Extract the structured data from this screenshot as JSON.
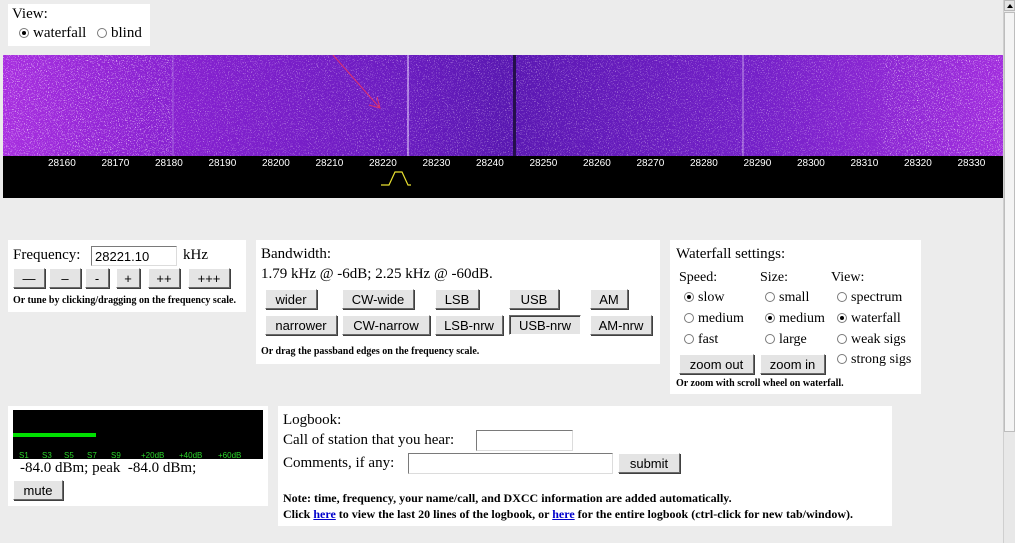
{
  "view_panel": {
    "title": "View:",
    "options": [
      {
        "label": "waterfall",
        "selected": true
      },
      {
        "label": "blind",
        "selected": false
      }
    ]
  },
  "waterfall": {
    "colors": {
      "base": "#8c1fd6",
      "dark": "#3c1478",
      "light": "#f2d6ff",
      "marker_arrow": "#e0306a"
    }
  },
  "scale": {
    "ticks": [
      "28160",
      "28170",
      "28180",
      "28190",
      "28200",
      "28210",
      "28220",
      "28230",
      "28240",
      "28250",
      "28260",
      "28270",
      "28280",
      "28290",
      "28300",
      "28310",
      "28320",
      "28330"
    ]
  },
  "frequency": {
    "label": "Frequency:",
    "value": "28221.10",
    "unit": "kHz",
    "buttons": [
      "—",
      "–",
      "-",
      "+",
      "++",
      "+++"
    ],
    "hint": "Or tune by clicking/dragging on the frequency scale."
  },
  "bandwidth": {
    "title": "Bandwidth:",
    "info": "1.79 kHz @ -6dB; 2.25 kHz @ -60dB.",
    "row1": [
      "wider",
      "CW-wide",
      "LSB",
      "USB",
      "AM"
    ],
    "row2": [
      "narrower",
      "CW-narrow",
      "LSB-nrw",
      "USB-nrw",
      "AM-nrw"
    ],
    "selected": "USB-nrw",
    "hint": "Or drag the passband edges on the frequency scale."
  },
  "waterfall_settings": {
    "title": "Waterfall settings:",
    "speed": {
      "header": "Speed:",
      "options": [
        {
          "label": "slow",
          "selected": true
        },
        {
          "label": "medium",
          "selected": false
        },
        {
          "label": "fast",
          "selected": false
        }
      ]
    },
    "size": {
      "header": "Size:",
      "options": [
        {
          "label": "small",
          "selected": false
        },
        {
          "label": "medium",
          "selected": true
        },
        {
          "label": "large",
          "selected": false
        }
      ]
    },
    "view": {
      "header": "View:",
      "options": [
        {
          "label": "spectrum",
          "selected": false
        },
        {
          "label": "waterfall",
          "selected": true
        },
        {
          "label": "weak sigs",
          "selected": false
        },
        {
          "label": "strong sigs",
          "selected": false
        }
      ]
    },
    "zoom_out": "zoom out",
    "zoom_in": "zoom in",
    "hint": "Or zoom with scroll wheel on waterfall."
  },
  "smeter": {
    "labels": [
      "S1",
      "S3",
      "S5",
      "S7",
      "S9",
      "+20dB",
      "+40dB",
      "+60dB"
    ],
    "level_fraction": 0.33,
    "readout": "-84.0 dBm; peak  -84.0 dBm;",
    "mute": "mute",
    "bar_color": "#00e000"
  },
  "logbook": {
    "title": "Logbook:",
    "call_label": "Call of station that you hear:",
    "call_value": "",
    "comments_label": "Comments, if any:",
    "comments_value": "",
    "submit": "submit",
    "note": "Note: time, frequency, your name/call, and DXCC information are added automatically.",
    "click": "Click",
    "here1": "here",
    "mid": "to view the last 20 lines of the logbook, or",
    "here2": "here",
    "tail": "for the entire logbook (ctrl-click for new tab/window)."
  }
}
